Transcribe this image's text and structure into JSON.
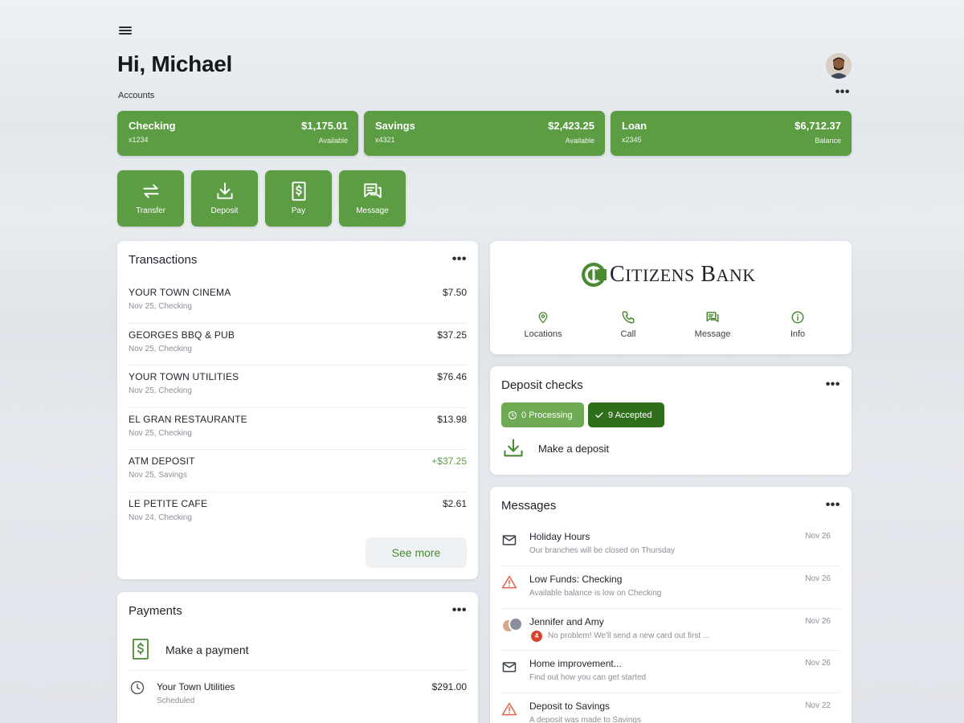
{
  "header": {
    "greeting": "Hi, Michael"
  },
  "accounts": {
    "label": "Accounts",
    "items": [
      {
        "name": "Checking",
        "number": "x1234",
        "balance": "$1,175.01",
        "balance_label": "Available"
      },
      {
        "name": "Savings",
        "number": "x4321",
        "balance": "$2,423.25",
        "balance_label": "Available"
      },
      {
        "name": "Loan",
        "number": "x2345",
        "balance": "$6,712.37",
        "balance_label": "Balance"
      }
    ]
  },
  "actions": [
    {
      "label": "Transfer",
      "icon": "transfer-icon"
    },
    {
      "label": "Deposit",
      "icon": "deposit-icon"
    },
    {
      "label": "Pay",
      "icon": "pay-icon"
    },
    {
      "label": "Message",
      "icon": "message-icon"
    }
  ],
  "transactions": {
    "title": "Transactions",
    "items": [
      {
        "merchant": "YOUR TOWN CINEMA",
        "detail": "Nov 25, Checking",
        "amount": "$7.50"
      },
      {
        "merchant": "GEORGES BBQ & PUB",
        "detail": "Nov 25, Checking",
        "amount": "$37.25"
      },
      {
        "merchant": "YOUR TOWN UTILITIES",
        "detail": "Nov 25, Checking",
        "amount": "$76.46"
      },
      {
        "merchant": "EL GRAN RESTAURANTE",
        "detail": "Nov 25, Checking",
        "amount": "$13.98"
      },
      {
        "merchant": "ATM DEPOSIT",
        "detail": "Nov 25, Savings",
        "amount": "+$37.25"
      },
      {
        "merchant": "LE PETITE CAFE",
        "detail": "Nov 24, Checking",
        "amount": "$2.61"
      }
    ],
    "see_more": "See more"
  },
  "payments": {
    "title": "Payments",
    "make_payment": "Make a payment",
    "items": [
      {
        "payee": "Your Town Utilities",
        "status": "Scheduled",
        "amount": "$291.00"
      }
    ]
  },
  "bank": {
    "name_first": "C",
    "name_first_rest": "ITIZENS",
    "name_second": "B",
    "name_second_rest": "ANK",
    "links": [
      {
        "label": "Locations",
        "icon": "location-pin-icon"
      },
      {
        "label": "Call",
        "icon": "phone-icon"
      },
      {
        "label": "Message",
        "icon": "chat-icon"
      },
      {
        "label": "Info",
        "icon": "info-icon"
      }
    ],
    "brand_color": "#4b8a33"
  },
  "deposit_checks": {
    "title": "Deposit checks",
    "processing": "0 Processing",
    "accepted": "9 Accepted",
    "make_deposit": "Make a deposit"
  },
  "messages": {
    "title": "Messages",
    "items": [
      {
        "subject": "Holiday Hours",
        "preview": "Our branches will be closed on Thursday",
        "date": "Nov 26",
        "icon": "envelope-icon"
      },
      {
        "subject": "Low Funds: Checking",
        "preview": "Available balance is low on Checking",
        "date": "Nov 26",
        "icon": "warning-icon"
      },
      {
        "subject": "Jennifer and Amy",
        "preview": "No problem! We'll send a new card out first ...",
        "date": "Nov 26",
        "icon": "group-avatar-icon",
        "badge": "4"
      },
      {
        "subject": "Home improvement...",
        "preview": "Find out how you can get started",
        "date": "Nov 26",
        "icon": "envelope-icon"
      },
      {
        "subject": "Deposit to Savings",
        "preview": "A deposit was made to Savings",
        "date": "Nov 22",
        "icon": "warning-icon"
      }
    ]
  },
  "colors": {
    "accent": "#5c9c43",
    "accent_dark": "#2f6e1b",
    "alert": "#d8432e",
    "warning": "#e0634a"
  }
}
